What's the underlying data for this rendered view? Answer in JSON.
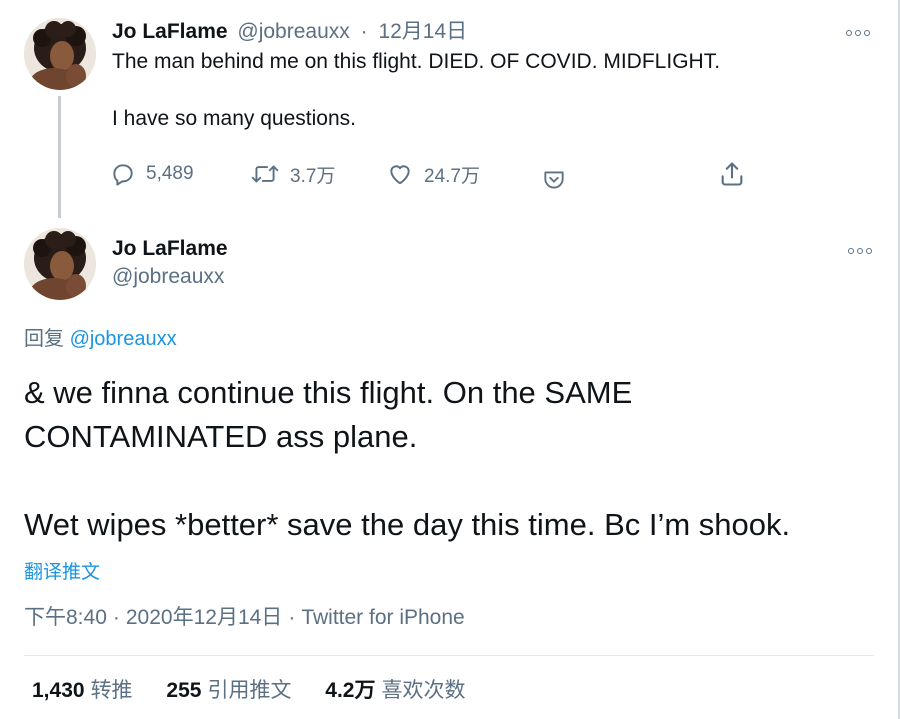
{
  "first_tweet": {
    "author_name": "Jo LaFlame",
    "author_handle": "@jobreauxx",
    "separator": "·",
    "date": "12月14日",
    "text_line1": "The man behind me on this flight. DIED. OF COVID. MIDFLIGHT.",
    "text_line2": "I have so many questions.",
    "actions": {
      "reply_icon": "comment-icon",
      "reply_count": "5,489",
      "retweet_icon": "retweet-icon",
      "retweet_count": "3.7万",
      "like_icon": "heart-icon",
      "like_count": "24.7万",
      "save_icon": "pocket-save-icon",
      "share_icon": "share-icon"
    }
  },
  "main_tweet": {
    "author_name": "Jo LaFlame",
    "author_handle": "@jobreauxx",
    "reply_label": "回复",
    "reply_to": "@jobreauxx",
    "text_para1": "& we finna continue this flight. On the SAME CONTAMINATED ass plane.",
    "text_para2": "Wet wipes *better* save the day this time. Bc I’m shook.",
    "translate_label": "翻译推文",
    "time": "下午8:40",
    "meta_sep": "·",
    "date": "2020年12月14日",
    "source": "Twitter for iPhone",
    "stats": {
      "retweets_count": "1,430",
      "retweets_label": "转推",
      "quotes_count": "255",
      "quotes_label": "引用推文",
      "likes_count": "4.2万",
      "likes_label": "喜欢次数"
    }
  },
  "colors": {
    "text": "#0f1419",
    "secondary": "#5b7083",
    "link": "#1b95e0",
    "divider": "#e1e8ed",
    "thread_line": "#c8cdd2"
  }
}
